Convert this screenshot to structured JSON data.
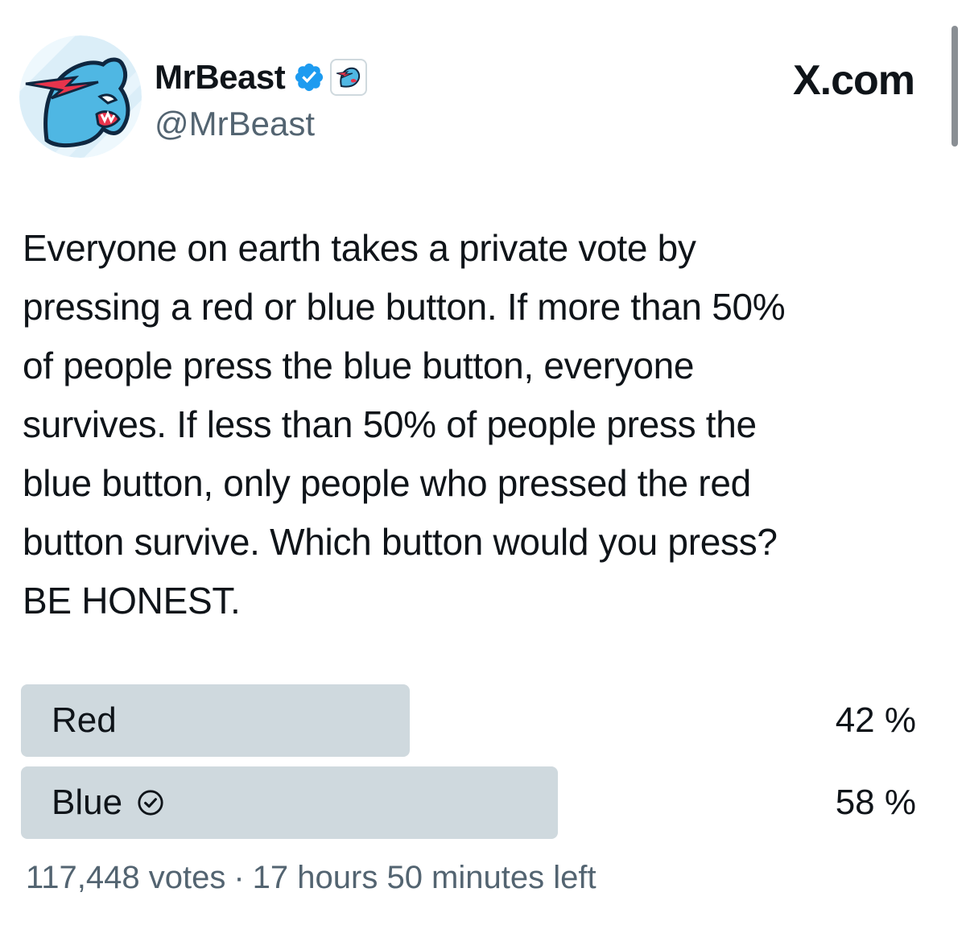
{
  "author": {
    "display_name": "MrBeast",
    "handle": "@MrBeast",
    "verified": true,
    "avatar_icon": "mrbeast-panther-logo",
    "affiliate_icon": "mrbeast-affiliate-badge-icon"
  },
  "site_label": "X.com",
  "tweet": {
    "text": "Everyone on earth takes a private vote by\npressing a red or blue button. If more than 50%\nof people press the blue button, everyone\nsurvives. If less than 50% of people press the\nblue button, only people who pressed the red\nbutton survive. Which button would you press?\nBE HONEST."
  },
  "poll": {
    "options": [
      {
        "label": "Red",
        "percent_text": "42 %",
        "percent": 42,
        "user_choice": false
      },
      {
        "label": "Blue",
        "percent_text": "58 %",
        "percent": 58,
        "user_choice": true
      }
    ],
    "votes": "117,448 votes",
    "separator": "·",
    "time_left": "17 hours 50 minutes left"
  },
  "colors": {
    "poll_bar": "#cfd9de",
    "verified_badge": "#1d9bf0",
    "secondary_text": "#536471",
    "logo_blue": "#4fb7e3",
    "logo_red": "#e8344c"
  }
}
